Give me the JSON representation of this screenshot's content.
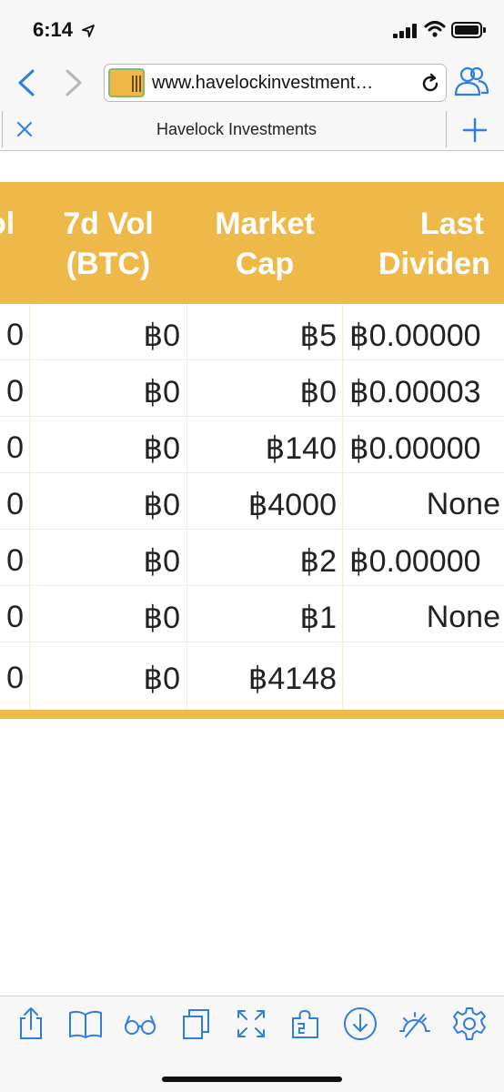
{
  "status_bar": {
    "time": "6:14"
  },
  "browser": {
    "url": "www.havelockinvestment…",
    "tab_title": "Havelock Investments"
  },
  "colors": {
    "accent": "#efb94a",
    "ios_blue": "#2f7de1",
    "text": "#222222"
  },
  "table": {
    "headers": [
      {
        "line1": "ol",
        "line2": ""
      },
      {
        "line1": "7d Vol",
        "line2": "(BTC)"
      },
      {
        "line1": "Market",
        "line2": "Cap"
      },
      {
        "line1": "Last",
        "line2": "Dividen"
      }
    ],
    "rows": [
      {
        "c0": "0",
        "c1": "฿0",
        "c2": "฿5",
        "c3": "฿0.00000"
      },
      {
        "c0": "0",
        "c1": "฿0",
        "c2": "฿0",
        "c3": "฿0.00003"
      },
      {
        "c0": "0",
        "c1": "฿0",
        "c2": "฿140",
        "c3": "฿0.00000"
      },
      {
        "c0": "0",
        "c1": "฿0",
        "c2": "฿4000",
        "c3": "None"
      },
      {
        "c0": "0",
        "c1": "฿0",
        "c2": "฿2",
        "c3": "฿0.00000"
      },
      {
        "c0": "0",
        "c1": "฿0",
        "c2": "฿1",
        "c3": "None"
      },
      {
        "c0": "0",
        "c1": "฿0",
        "c2": "฿4148",
        "c3": ""
      }
    ]
  },
  "bottom_toolbar": [
    "share-icon",
    "bookmarks-icon",
    "reader-icon",
    "tabs-icon",
    "fullscreen-icon",
    "extensions-icon",
    "downloads-icon",
    "night-mode-icon",
    "settings-icon"
  ]
}
